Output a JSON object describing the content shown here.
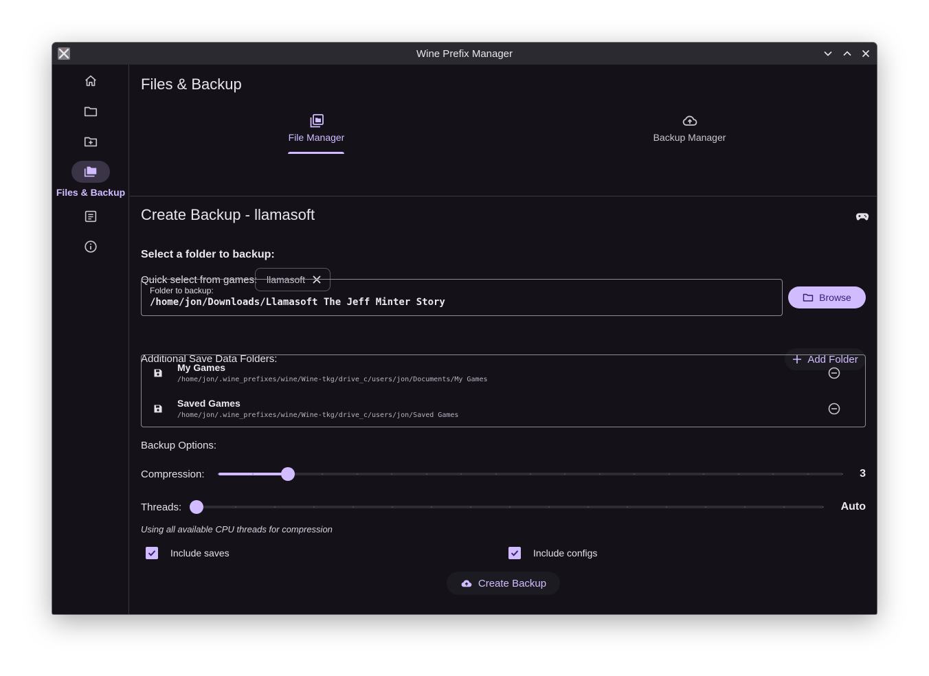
{
  "window": {
    "title": "Wine Prefix Manager"
  },
  "nav": {
    "items": [
      {
        "icon": "home-icon",
        "label": ""
      },
      {
        "icon": "folder-icon",
        "label": ""
      },
      {
        "icon": "create-folder-icon",
        "label": ""
      },
      {
        "icon": "files-backup-icon",
        "label": "Files & Backup",
        "active": true
      },
      {
        "icon": "list-icon",
        "label": ""
      },
      {
        "icon": "info-icon",
        "label": ""
      }
    ]
  },
  "page": {
    "title": "Files & Backup"
  },
  "tabs": [
    {
      "label": "File Manager",
      "icon": "library-icon",
      "active": true
    },
    {
      "label": "Backup Manager",
      "icon": "cloud-upload-icon",
      "active": false
    }
  ],
  "backup": {
    "title": "Create Backup - llamasoft",
    "select_heading": "Select a folder to backup:",
    "quick_select_label": "Quick select from games:",
    "quick_select_chip": "llamasoft",
    "folder_field": {
      "label": "Folder to backup:",
      "value": "/home/jon/Downloads/Llamasoft The Jeff Minter Story"
    },
    "browse_label": "Browse",
    "additional_label": "Additional Save Data Folders:",
    "add_folder_label": "Add Folder",
    "folders": [
      {
        "name": "My Games",
        "path": "/home/jon/.wine_prefixes/wine/Wine-tkg/drive_c/users/jon/Documents/My Games"
      },
      {
        "name": "Saved Games",
        "path": "/home/jon/.wine_prefixes/wine/Wine-tkg/drive_c/users/jon/Saved Games"
      }
    ],
    "options_label": "Backup Options:",
    "compression": {
      "label": "Compression:",
      "value": "3",
      "level": 3,
      "min": 1,
      "max": 19
    },
    "threads": {
      "label": "Threads:",
      "value": "Auto",
      "level": 0,
      "min": 0,
      "max": 16
    },
    "threads_hint": "Using all available CPU threads for compression",
    "include_saves": {
      "label": "Include saves",
      "checked": true
    },
    "include_configs": {
      "label": "Include configs",
      "checked": true
    },
    "create_label": "Create Backup"
  },
  "colors": {
    "accent": "#d0bcff",
    "background": "#141218",
    "titlebar": "#2b2a30"
  }
}
